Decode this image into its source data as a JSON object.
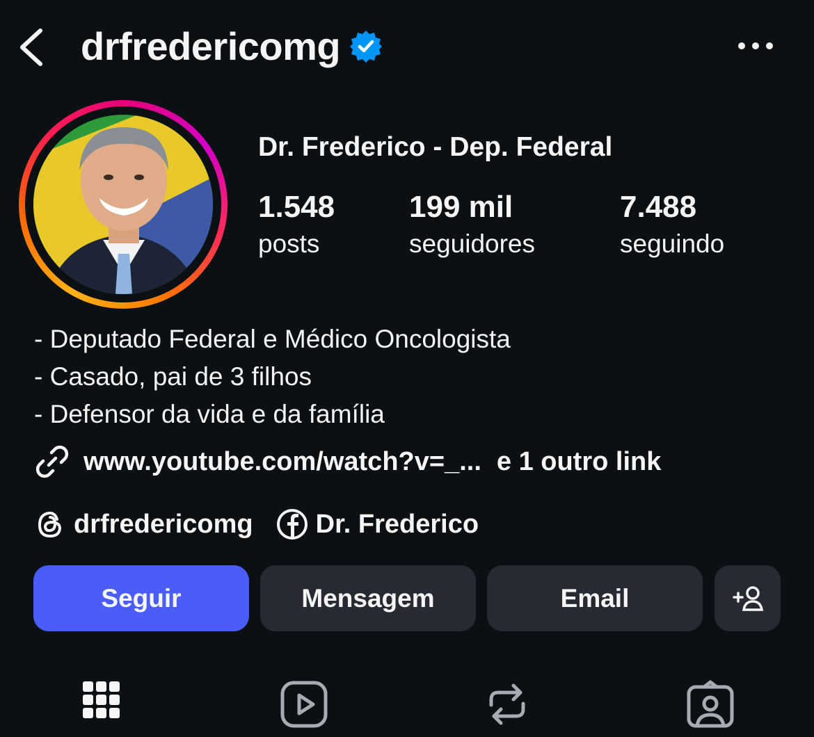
{
  "header": {
    "username": "drfredericomg",
    "back_icon": "chevron-left-icon",
    "verified_icon": "verified-badge-icon",
    "more_icon": "more-horizontal-icon"
  },
  "profile": {
    "display_name": "Dr. Frederico - Dep. Federal",
    "stats": [
      {
        "value": "1.548",
        "label": "posts"
      },
      {
        "value": "199 mil",
        "label": "seguidores"
      },
      {
        "value": "7.488",
        "label": "seguindo"
      }
    ],
    "bio": [
      "- Deputado Federal e Médico Oncologista",
      "- Casado, pai de 3 filhos",
      "- Defensor da vida e da família"
    ],
    "link": {
      "icon": "link-icon",
      "url_text": "www.youtube.com/watch?v=_...",
      "more_text": "e 1 outro link"
    },
    "social": [
      {
        "icon": "threads-icon",
        "label": "drfredericomg"
      },
      {
        "icon": "facebook-icon",
        "label": "Dr. Frederico"
      }
    ]
  },
  "actions": {
    "follow_label": "Seguir",
    "message_label": "Mensagem",
    "email_label": "Email",
    "suggest_icon": "add-person-icon"
  },
  "tabs": [
    "grid-icon",
    "reels-icon",
    "reposts-icon",
    "tagged-icon"
  ],
  "colors": {
    "background": "#0b1014",
    "button_primary": "#4a5df9",
    "button_secondary": "#262b33",
    "verified_blue": "#0095f6",
    "text": "#f5f5f5"
  }
}
